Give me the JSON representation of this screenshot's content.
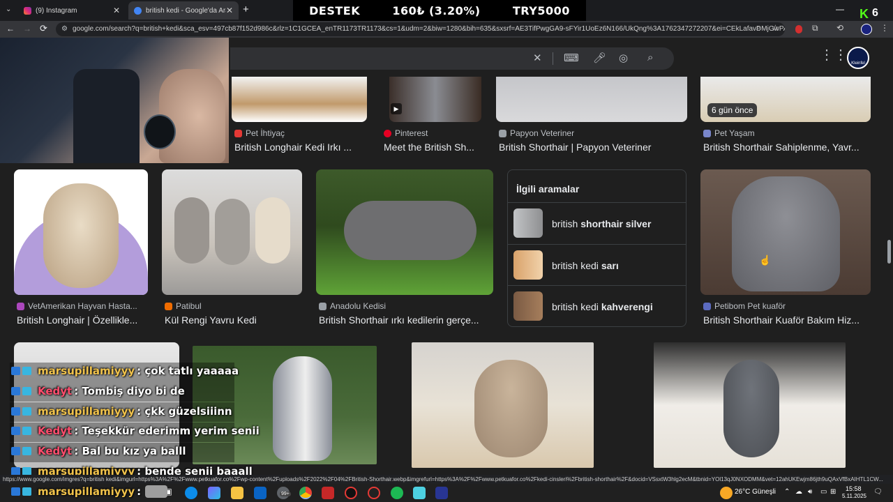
{
  "browser": {
    "tabs": [
      {
        "label": "(9) Instagram",
        "color": "#e1306c",
        "active": false
      },
      {
        "label": "british kedi - Google'da Ara",
        "color": "#4285f4",
        "active": true
      }
    ],
    "new_tab": "+",
    "url": "google.com/search?q=british+kedi&sca_esv=497cb87f152d986c&rlz=1C1GCEA_enTR1173TR1173&cs=1&udm=2&biw=1280&bih=635&sxsrf=AE3TifPwgGA9-sFYir1UoEz6N166/UkQng%3A1762347272207&ei=CEkLafavDMjGwPAPiOq..."
  },
  "stream_overlay": {
    "left": "DESTEK",
    "middle": "160₺ (3.20%)",
    "right": "TRY5000"
  },
  "kick_badge": {
    "letter": "K",
    "count": "6"
  },
  "header": {
    "avatar_label": "Kleinfel"
  },
  "results_row1": [
    {
      "source": "Pet İhtiyaç",
      "title": "British Longhair Kedi Irkı ...",
      "fav_color": "#e53935"
    },
    {
      "source": "Pinterest",
      "title": "Meet the British Sh...",
      "fav_color": "#e60023"
    },
    {
      "source": "Papyon Veteriner",
      "title": "British Shorthair | Papyon Veteriner",
      "fav_color": "#9aa0a6"
    },
    {
      "source": "Pet Yaşam",
      "title": "British Shorthair Sahiplenme, Yavr...",
      "fav_color": "#7986cb",
      "badge": "6 gün önce"
    }
  ],
  "results_row2": [
    {
      "source": "VetAmerikan Hayvan Hasta...",
      "title": "British Longhair | Özellikle...",
      "fav_color": "#ab47bc"
    },
    {
      "source": "Patibul",
      "title": "Kül Rengi Yavru Kedi",
      "fav_color": "#ef6c00"
    },
    {
      "source": "Anadolu Kedisi",
      "title": "British Shorthair ırkı kedilerin gerçe...",
      "fav_color": "#9aa0a6"
    },
    {
      "source": "Petibom Pet kuaför",
      "title": "British Shorthair Kuaför Bakım Hiz...",
      "fav_color": "#5c6bc0"
    }
  ],
  "related": {
    "title": "İlgili aramalar",
    "items": [
      {
        "prefix": "british ",
        "bold": "shorthair silver"
      },
      {
        "prefix": "british kedi ",
        "bold": "sarı"
      },
      {
        "prefix": "british kedi ",
        "bold": "kahverengi"
      }
    ]
  },
  "chat": [
    {
      "user": "marsupillamiyyy",
      "user_color": "#f0c24b",
      "message": ": çok tatlı yaaaaa"
    },
    {
      "user": "Kedyt",
      "user_color": "#ff4d6d",
      "message": ": Tombiş diyo bi de"
    },
    {
      "user": "marsupillamiyyy",
      "user_color": "#f0c24b",
      "message": ": çkk güzelsiiinn"
    },
    {
      "user": "Kedyt",
      "user_color": "#ff4d6d",
      "message": ": Teşekkür ederimm yerim senii"
    },
    {
      "user": "Kedyt",
      "user_color": "#ff4d6d",
      "message": ": Bal bu kız ya balll"
    },
    {
      "user": "marsupillamiyyy",
      "user_color": "#f0c24b",
      "message": ": bende senii baaall"
    },
    {
      "user": "marsupillamiyyy",
      "user_color": "#f0c24b",
      "message": ":"
    }
  ],
  "status_url": "https://www.google.com/imgres?q=british kedi&imgurl=https%3A%2F%2Fwww.petkuafor.co%2Fwp-content%2Fuploads%2F2022%2F04%2FBritish-Shorthair.webp&imgrefurl=https%3A%2F%2Fwww.petkuafor.co%2Fkedi-cinsleri%2Fbritish-shorthair%2F&docid=VSsxtW3hlg2ecM&tbnid=YOl13qJ0NXODMM&vet=12ahUKEwjm86jth9uQAxVfBxAIHTL1CW...",
  "taskbar": {
    "badge": "99+",
    "weather": "26°C  Güneşli",
    "time": "15:58",
    "date": "5.11.2025"
  }
}
